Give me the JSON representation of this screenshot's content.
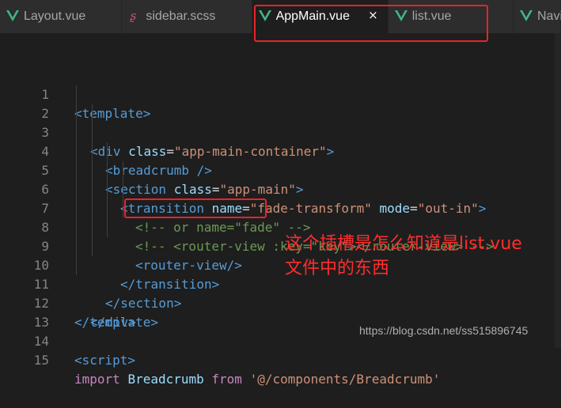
{
  "tabs": [
    {
      "label": "Layout.vue",
      "icon": "vue-icon",
      "active": false
    },
    {
      "label": "sidebar.scss",
      "icon": "sass-icon",
      "active": false
    },
    {
      "label": "AppMain.vue",
      "icon": "vue-icon",
      "active": true,
      "close": "×"
    },
    {
      "label": "list.vue",
      "icon": "vue-icon",
      "active": false
    },
    {
      "label": "Navi",
      "icon": "vue-icon",
      "active": false
    }
  ],
  "colors": {
    "accent_red": "#e8232a",
    "vue_green": "#41b883",
    "sass_pink": "#c6538c",
    "tag": "#569cd6",
    "attr": "#9cdcfe",
    "string": "#ce9178",
    "comment": "#6a9955"
  },
  "code": {
    "line_numbers": [
      "1",
      "2",
      "3",
      "4",
      "5",
      "6",
      "7",
      "8",
      "9",
      "10",
      "11",
      "12",
      "13",
      "14",
      "15"
    ],
    "l1": "<template>",
    "l2_a": "<div ",
    "l2_b": "class",
    "l2_c": "=",
    "l2_d": "\"app-main-container\"",
    "l2_e": ">",
    "l3": "<breadcrumb />",
    "l4_a": "<section ",
    "l4_b": "class",
    "l4_c": "=",
    "l4_d": "\"app-main\"",
    "l4_e": ">",
    "l5_a": "<transition ",
    "l5_b": "name",
    "l5_c": "=",
    "l5_d": "\"fade-transform\"",
    "l5_e": " mode",
    "l5_f": "=",
    "l5_g": "\"out-in\"",
    "l5_h": ">",
    "l6": "<!-- or name=\"fade\" -->",
    "l7": "<!-- <router-view :key=\"key\"></router-view> -->",
    "l8": "<router-view/>",
    "l9": "</transition>",
    "l10": "</section>",
    "l11": "</div>",
    "l12": "</template>",
    "l13": "",
    "l14": "<script>",
    "l15_a": "import ",
    "l15_b": "Breadcrumb",
    "l15_c": " from ",
    "l15_d": "'@/components/Breadcrumb'"
  },
  "annotation": {
    "line1": "这个插槽是怎么知道是list.vue",
    "line2": "文件中的东西"
  },
  "watermark": "https://blog.csdn.net/ss515896745"
}
